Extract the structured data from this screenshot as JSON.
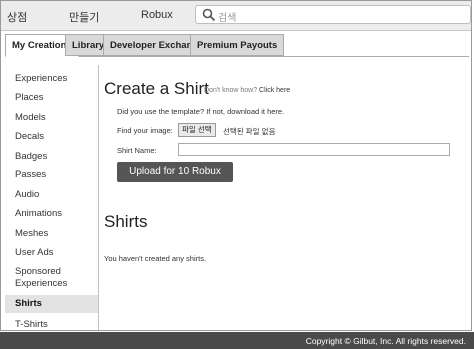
{
  "topbar": {
    "nav": [
      "상점",
      "만들기",
      "Robux"
    ],
    "search_placeholder": "검색"
  },
  "tabs": [
    {
      "label": "My Creations",
      "active": true
    },
    {
      "label": "Library",
      "active": false
    },
    {
      "label": "Developer Exchange",
      "active": false
    },
    {
      "label": "Premium Payouts",
      "active": false
    }
  ],
  "sidebar": {
    "items": [
      {
        "label": "Experiences"
      },
      {
        "label": "Places"
      },
      {
        "label": "Models"
      },
      {
        "label": "Decals"
      },
      {
        "label": "Badges"
      },
      {
        "label": "Passes"
      },
      {
        "label": "Audio"
      },
      {
        "label": "Animations"
      },
      {
        "label": "Meshes"
      },
      {
        "label": "User Ads"
      },
      {
        "label": "Sponsored Experiences"
      },
      {
        "label": "Shirts",
        "active": true
      },
      {
        "label": "T-Shirts"
      }
    ]
  },
  "create": {
    "title": "Create a Shirt",
    "help_prefix": "Don't know how?",
    "help_link": "Click here",
    "template_text": "Did you use the template? If not, download it here.",
    "image_label": "Find your image:",
    "file_button": "파일 선택",
    "file_status": "선택된 파일 없음",
    "name_label": "Shirt Name:",
    "name_value": "",
    "upload_button": "Upload for 10 Robux"
  },
  "shirts": {
    "title": "Shirts",
    "empty_text": "You haven't created any shirts."
  },
  "footer": {
    "copyright": "Copyright © Gilbut, Inc. All rights reserved."
  },
  "colors": {
    "upload_button_bg": "#555555",
    "footer_bg": "#4a4a4a"
  }
}
